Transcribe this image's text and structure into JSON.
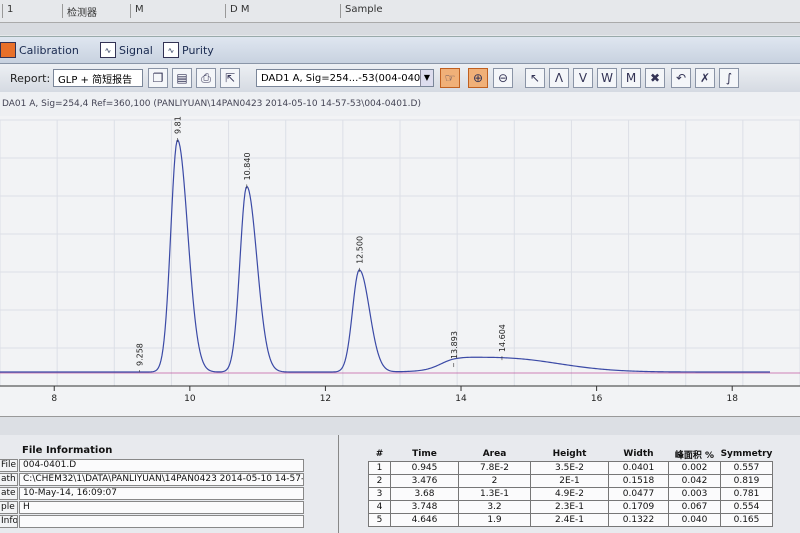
{
  "header_strip": {
    "cols": [
      "1",
      "检测器",
      "M",
      "D M",
      "Sample"
    ]
  },
  "tabs": [
    {
      "label": "Calibration",
      "icon": "calibration-icon"
    },
    {
      "label": "Signal",
      "icon": "signal-icon"
    },
    {
      "label": "Purity",
      "icon": "purity-icon"
    }
  ],
  "toolbar": {
    "report_label": "Report:",
    "report_value": "GLP + 简短报告",
    "signal_value": "DAD1 A, Sig=254...-53(004-0401.D)"
  },
  "signal_description": "DA01 A, Sig=254,4 Ref=360,100 (PANLIYUAN\\14PAN0423 2014-05-10 14-57-53\\004-0401.D)",
  "chart_data": {
    "type": "line",
    "xlabel": "",
    "ylabel": "",
    "xlim": [
      7.2,
      19.0
    ],
    "x_ticks": [
      8,
      10,
      12,
      14,
      16,
      18
    ],
    "peak_labels": [
      "9.258",
      "9.819",
      "10.840",
      "12.500",
      "13.893",
      "14.604"
    ],
    "peaks": [
      {
        "rt": 9.258,
        "height": 0.0
      },
      {
        "rt": 9.819,
        "height": 1.0
      },
      {
        "rt": 10.84,
        "height": 0.8
      },
      {
        "rt": 12.5,
        "height": 0.44
      },
      {
        "rt": 13.893,
        "height": 0.03
      },
      {
        "rt": 14.604,
        "height": 0.06
      }
    ],
    "grid": true
  },
  "file_info": {
    "title": "File Information",
    "rows": [
      {
        "key": "File",
        "value": "004-0401.D"
      },
      {
        "key": "ath",
        "value": "C:\\CHEM32\\1\\DATA\\PANLIYUAN\\14PAN0423 2014-05-10 14-57-!"
      },
      {
        "key": "ate",
        "value": "10-May-14, 16:09:07"
      },
      {
        "key": "ple",
        "value": "H"
      },
      {
        "key": "Info",
        "value": ""
      },
      {
        "key": "ation",
        "value": ""
      }
    ]
  },
  "peak_table": {
    "headers": [
      "#",
      "Time",
      "Area",
      "Height",
      "Width",
      "峰面积 %",
      "Symmetry"
    ],
    "rows": [
      [
        "1",
        "0.945",
        "7.8E-2",
        "3.5E-2",
        "0.0401",
        "0.002",
        "0.557"
      ],
      [
        "2",
        "3.476",
        "2",
        "2E-1",
        "0.1518",
        "0.042",
        "0.819"
      ],
      [
        "3",
        "3.68",
        "1.3E-1",
        "4.9E-2",
        "0.0477",
        "0.003",
        "0.781"
      ],
      [
        "4",
        "3.748",
        "3.2",
        "2.3E-1",
        "0.1709",
        "0.067",
        "0.554"
      ],
      [
        "5",
        "4.646",
        "1.9",
        "2.4E-1",
        "0.1322",
        "0.040",
        "0.165"
      ]
    ]
  }
}
